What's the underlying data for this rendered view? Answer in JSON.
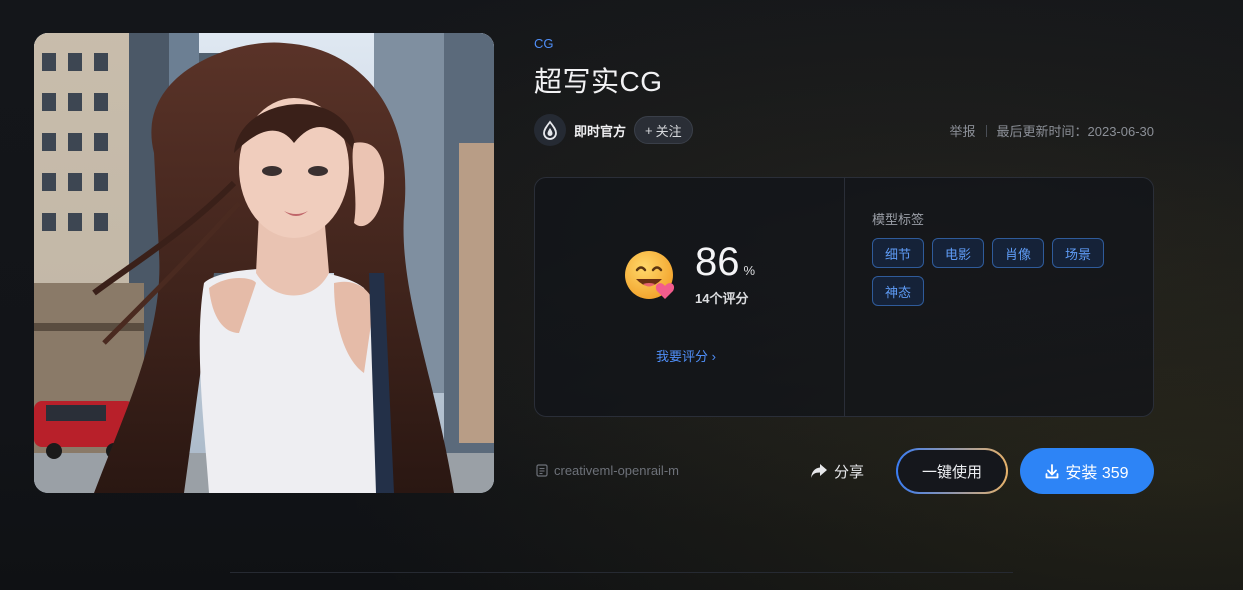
{
  "breadcrumb": "CG",
  "title": "超写实CG",
  "author": {
    "name": "即时官方",
    "follow_label": "关注"
  },
  "meta": {
    "report": "举报",
    "updated": "最后更新时间：2023-06-30"
  },
  "rating": {
    "score": "86",
    "unit": "%",
    "count": "14个评分",
    "rate_link": "我要评分"
  },
  "tags": {
    "title": "模型标签",
    "items": [
      "细节",
      "电影",
      "肖像",
      "场景",
      "神态"
    ]
  },
  "license": "creativeml-openrail-m",
  "actions": {
    "share": "分享",
    "use": "一键使用",
    "install": "安装 359"
  },
  "colors": {
    "accent": "#2d84f6",
    "link": "#4f8ef7",
    "tag_text": "#5e9bf5",
    "background": "#101216"
  },
  "icons": [
    "logo-icon",
    "plus-icon",
    "emoji-icon",
    "chevron-right-icon",
    "document-icon",
    "share-icon",
    "download-icon"
  ]
}
